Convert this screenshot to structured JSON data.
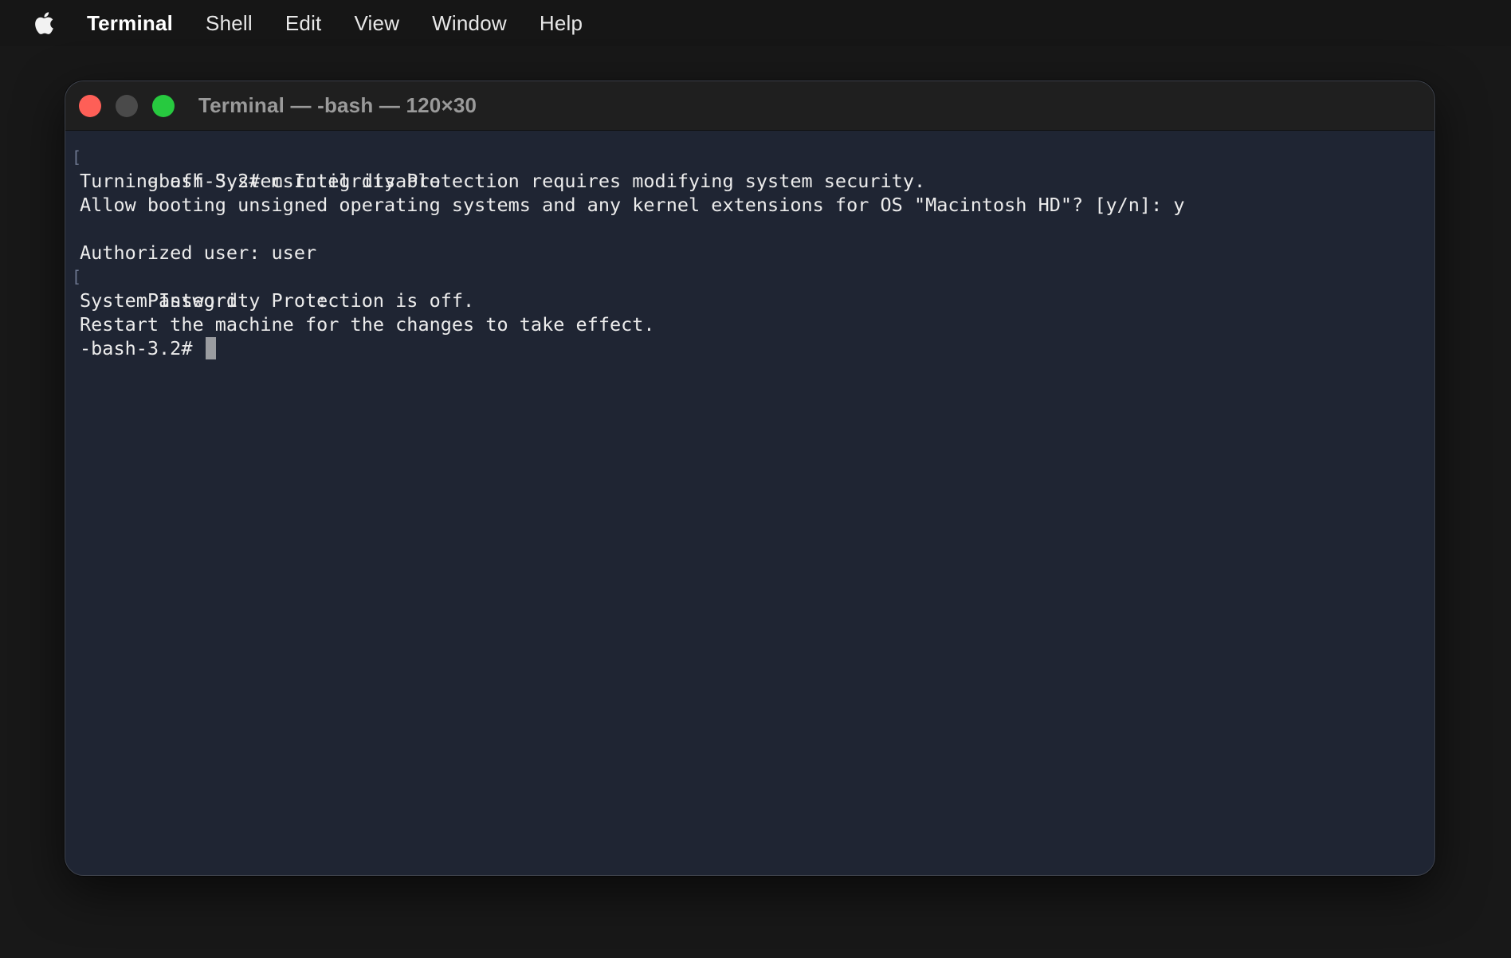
{
  "menubar": {
    "apple_icon": "apple-logo-icon",
    "app_name": "Terminal",
    "items": [
      "Shell",
      "Edit",
      "View",
      "Window",
      "Help"
    ]
  },
  "window": {
    "title": "Terminal — -bash — 120×30",
    "buttons": [
      "close",
      "minimize",
      "zoom"
    ],
    "colors": {
      "close": "#fe5f57",
      "minimize": "#4a4a4a",
      "zoom": "#27c93f",
      "background": "#1f2533"
    }
  },
  "terminal": {
    "lines": [
      "-bash-3.2# csrutil disable",
      "Turning off System Integrity Protection requires modifying system security.",
      "Allow booting unsigned operating systems and any kernel extensions for OS \"Macintosh HD\"? [y/n]: y",
      "",
      "Authorized user: user",
      "Password       :",
      "System Integrity Protection is off.",
      "Restart the machine for the changes to take effect."
    ],
    "prompt": "-bash-3.2# "
  }
}
